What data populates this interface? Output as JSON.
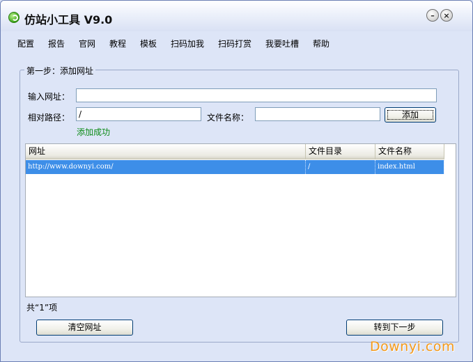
{
  "window": {
    "title": "仿站小工具 V9.0",
    "minimize_glyph": "–",
    "close_glyph": "×"
  },
  "menu": [
    {
      "label": "配置"
    },
    {
      "label": "报告"
    },
    {
      "label": "官网"
    },
    {
      "label": "教程"
    },
    {
      "label": "模板"
    },
    {
      "label": "扫码加我"
    },
    {
      "label": "扫码打赏"
    },
    {
      "label": "我要吐槽"
    },
    {
      "label": "帮助"
    }
  ],
  "step": {
    "legend": "第一步：添加网址",
    "url_label": "输入网址：",
    "url_value": "",
    "path_label": "相对路径：",
    "path_value": "/",
    "filename_label": "文件名称：",
    "filename_value": "",
    "add_button": "添加",
    "status": "添加成功"
  },
  "table": {
    "columns": [
      "网址",
      "文件目录",
      "文件名称"
    ],
    "rows": [
      {
        "url": "http://www.downyi.com/",
        "dir": "/",
        "file": "index.html"
      }
    ]
  },
  "footer": {
    "count_text": "共“1”项",
    "clear_button": "清空网址",
    "next_button": "转到下一步"
  },
  "watermark": "Downyi.com",
  "colors": {
    "selection": "#3d8ee8",
    "success_text": "#0a8a14",
    "watermark": "#f49a1a"
  }
}
